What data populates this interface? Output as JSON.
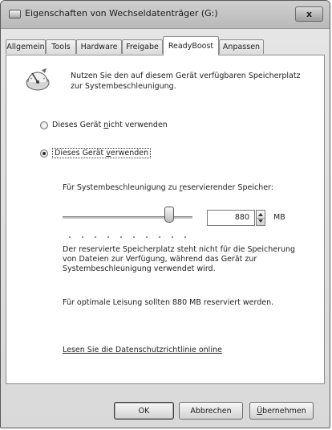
{
  "window": {
    "title": "Eigenschaften von Wechseldatenträger (G:)",
    "close_label": "x"
  },
  "tabs": [
    {
      "label": "Allgemein"
    },
    {
      "label": "Tools"
    },
    {
      "label": "Hardware"
    },
    {
      "label": "Freigabe"
    },
    {
      "label": "ReadyBoost",
      "active": true
    },
    {
      "label": "Anpassen"
    }
  ],
  "readyboost": {
    "icon": "readyboost-gauge-icon",
    "description": "Nutzen Sie den auf diesem Gerät verfügbaren Speicherplatz zur Systembeschleunigung.",
    "options": [
      {
        "pre": "Dieses Gerät ",
        "accel": "n",
        "post": "icht verwenden",
        "checked": false
      },
      {
        "pre": "Dieses Gerät ",
        "accel": "v",
        "post": "erwenden",
        "checked": true
      }
    ],
    "reserve_label_pre": "Für Systembeschleunigung zu ",
    "reserve_label_accel": "r",
    "reserve_label_post": "eservierender Speicher:",
    "slider_fraction": 0.82,
    "reserve_value": "880",
    "unit": "MB",
    "info_text": "Der reservierte Speicherplatz steht nicht für die Speicherung von Dateien zur Verfügung, während das Gerät zur Systembeschleunigung verwendet wird.",
    "recommendation": "Für optimale Leisung sollten 880 MB reserviert werden.",
    "privacy_link": "Lesen Sie die Datenschutzrichtlinie online"
  },
  "buttons": {
    "ok": "OK",
    "cancel": "Abbrechen",
    "apply_accel": "Ü",
    "apply_rest": "bernehmen"
  }
}
